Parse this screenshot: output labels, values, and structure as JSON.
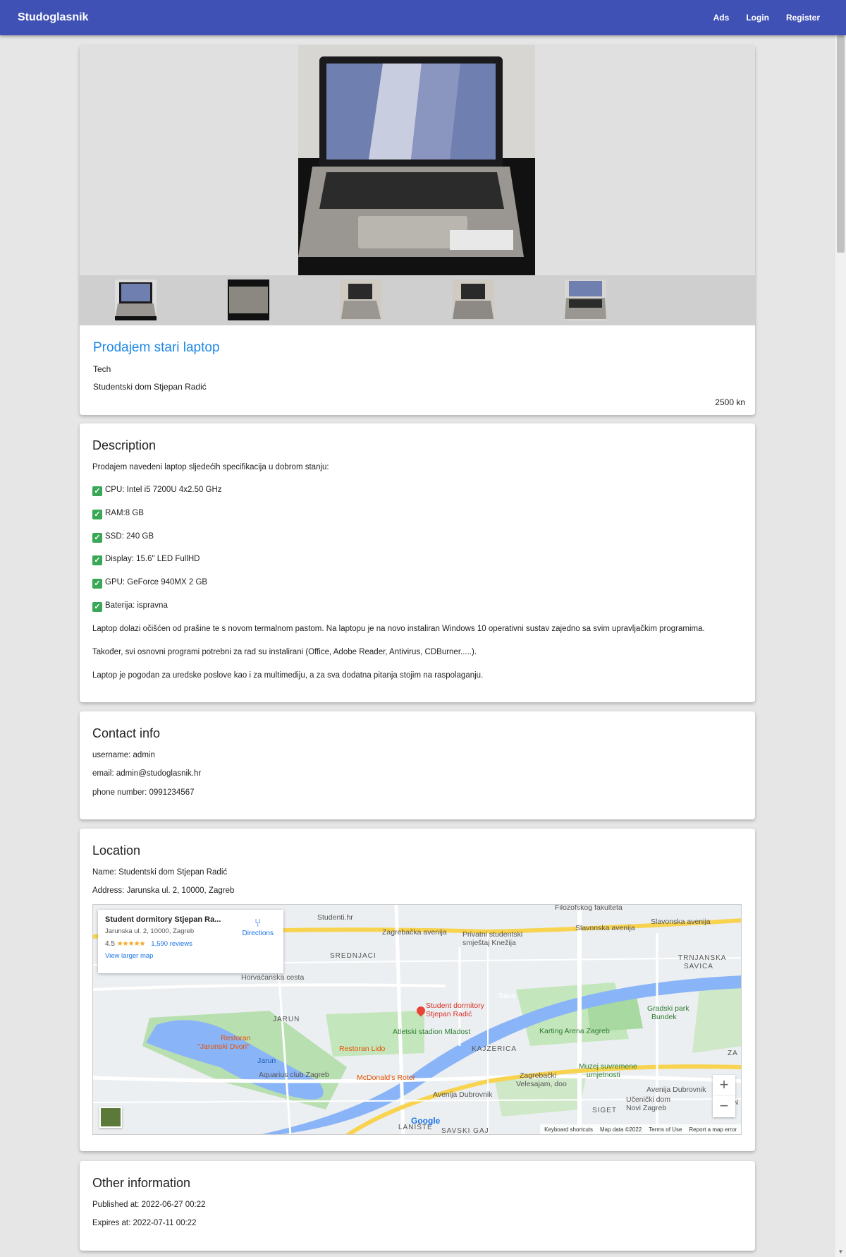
{
  "navbar": {
    "brand": "Studoglasnik",
    "links": [
      "Ads",
      "Login",
      "Register"
    ]
  },
  "ad": {
    "title": "Prodajem stari laptop",
    "category": "Tech",
    "location": "Studentski dom Stjepan Radić",
    "price": "2500 kn"
  },
  "description": {
    "heading": "Description",
    "intro": "Prodajem navedeni laptop sljedećih specifikacija u dobrom stanju:",
    "specs": [
      "CPU: Intel i5 7200U 4x2.50 GHz",
      "RAM:8 GB",
      "SSD: 240 GB",
      "Display: 15.6\" LED FullHD",
      "GPU: GeForce 940MX 2 GB",
      "Baterija: ispravna"
    ],
    "para1": "Laptop dolazi očišćen od prašine te s novom termalnom pastom. Na laptopu je na novo instaliran Windows 10 operativni sustav zajedno sa svim upravljačkim programima.",
    "para2": "Također, svi osnovni programi potrebni za rad su instalirani (Office, Adobe Reader, Antivirus, CDBurner.....).",
    "para3": "Laptop je pogodan za uredske poslove kao i za multimediju, a za sva dodatna pitanja stojim na raspolaganju."
  },
  "contact": {
    "heading": "Contact info",
    "username": "username: admin",
    "email": "email: admin@studoglasnik.hr",
    "phone": "phone number: 0991234567"
  },
  "location": {
    "heading": "Location",
    "name": "Name: Studentski dom Stjepan Radić",
    "address": "Address: Jarunska ul. 2, 10000, Zagreb",
    "map": {
      "place_name": "Student dormitory Stjepan Ra...",
      "place_address": "Jarunska ul. 2, 10000, Zagreb",
      "rating": "4.5",
      "stars": "★★★★★",
      "reviews": "1,590 reviews",
      "larger_map": "View larger map",
      "directions": "Directions",
      "marker_label_1": "Student dormitory",
      "marker_label_2": "Stjepan Radić",
      "labels": {
        "studenti": "Studenti.hr",
        "privatni1": "Privatni studentski",
        "privatni2": "smještaj Knežija",
        "srednjaci": "SREDNJACI",
        "trnjanska1": "TRNJANSKA",
        "trnjanska2": "SAVICA",
        "jarun": "JARUN",
        "kajzerica": "KAJZERICA",
        "atletski": "Atletski stadion Mladost",
        "karting": "Karting Arena Zagreb",
        "gradski1": "Gradski park",
        "gradski2": "Bundek",
        "restoran1": "Restoran",
        "restoran2": "\"Jarunski Dvori\"",
        "lido": "Restoran Lido",
        "aquarius": "Aquarius club Zagreb",
        "mcdonalds": "McDonald's Rotor",
        "velesajam1": "Zagrebački",
        "velesajam2": "Velesajam, doo",
        "muzej1": "Muzej suvremene",
        "muzej2": "umjetnosti",
        "ucenicki1": "Učenički dom",
        "ucenicki2": "Novi Zagreb",
        "siget": "SIGET",
        "laniste": "LANIŠTE",
        "savski": "SAVSKI GAJ",
        "zagrebacka": "Zagrebačka avenija",
        "slavonska": "Slavonska avenija",
        "slavonska2": "Slavonska avenija",
        "sava": "Sava",
        "jarun_lake": "Jarun",
        "horvacanska": "Horvaćanska cesta",
        "dubrovnik": "Avenija Dubrovnik",
        "dubrovnik2": "Avenija Dubrovnik",
        "filozofski": "Filozofskog fakulteta",
        "za": "ZA",
        "n": "N"
      },
      "zoom_in": "+",
      "zoom_out": "−",
      "google": "Google",
      "footer": [
        "Keyboard shortcuts",
        "Map data ©2022",
        "Terms of Use",
        "Report a map error"
      ]
    }
  },
  "other": {
    "heading": "Other information",
    "published": "Published at: 2022-06-27 00:22",
    "expires": "Expires at: 2022-07-11 00:22"
  },
  "colors": {
    "navbar": "#3f51b5",
    "title_link": "#1e88e5",
    "check": "#3aa757"
  }
}
